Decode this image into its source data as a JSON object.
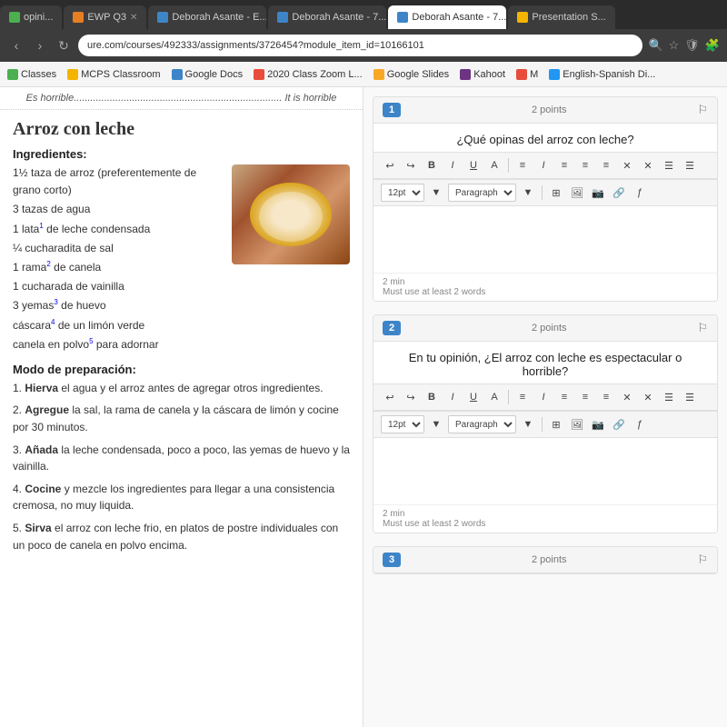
{
  "browser": {
    "tabs": [
      {
        "id": "tab1",
        "label": "opini...",
        "active": false,
        "icon_color": "#4CAF50"
      },
      {
        "id": "tab2",
        "label": "EWP Q3",
        "active": false,
        "icon_color": "#e67e22",
        "has_close": true
      },
      {
        "id": "tab3",
        "label": "Deborah Asante - E...",
        "active": false,
        "icon_color": "#3d85c8",
        "has_close": true
      },
      {
        "id": "tab4",
        "label": "Deborah Asante - 7...",
        "active": false,
        "icon_color": "#3d85c8",
        "has_close": true
      },
      {
        "id": "tab5",
        "label": "Deborah Asante - 7...",
        "active": true,
        "icon_color": "#3d85c8",
        "has_close": true
      },
      {
        "id": "tab6",
        "label": "Presentation S...",
        "active": false,
        "icon_color": "#f4b400"
      }
    ],
    "address": "ure.com/courses/492333/assignments/3726454?module_item_id=10166101",
    "bookmarks": [
      {
        "label": "Classes",
        "icon_color": "#4CAF50"
      },
      {
        "label": "MCPS Classroom",
        "icon_color": "#f4b400"
      },
      {
        "label": "Google Docs",
        "icon_color": "#3d85c8"
      },
      {
        "label": "2020 Class Zoom L...",
        "icon_color": "#e74c3c"
      },
      {
        "label": "Google Slides",
        "icon_color": "#f9a825"
      },
      {
        "label": "Kahoot",
        "icon_color": "#6c3483"
      },
      {
        "label": "M",
        "icon_color": "#e74c3c"
      },
      {
        "label": "English-Spanish Di...",
        "icon_color": "#2196F3"
      }
    ]
  },
  "recipe": {
    "header_spanish": "Es horrible...........................................................................",
    "header_english": "It is horrible",
    "title": "Arroz con leche",
    "ingredients_label": "Ingredientes:",
    "ingredients": [
      "1½ taza de arroz (preferentemente de grano corto)",
      "3 tazas de agua",
      "1 lata¹ de leche condensada",
      "¼ cucharadita de sal",
      "1 rama² de canela",
      "1 cucharada de vainilla",
      "3 yemas³ de huevo",
      "cáscara⁴ de un limón verde",
      "canela en polvo⁵ para adornar"
    ],
    "preparation_label": "Modo de preparación:",
    "steps": [
      {
        "num": "1.",
        "bold": "Hierva",
        "rest": " el agua y el arroz antes de agregar otros ingredientes."
      },
      {
        "num": "2.",
        "bold": "Agregue",
        "rest": " la sal, la rama de canela y la cáscara de limón y cocine por 30 minutos."
      },
      {
        "num": "3.",
        "bold": "Añada",
        "rest": " la leche condensada, poco a poco, las yemas de huevo y la vainilla."
      },
      {
        "num": "4.",
        "bold": "Cocine",
        "rest": " y mezcle los ingredientes para llegar a una consistencia cremosa, no muy liquida."
      },
      {
        "num": "5.",
        "bold": "Sirva",
        "rest": " el arroz con leche frio, en platos de postre individuales con un poco de canela en polvo encima."
      }
    ]
  },
  "quiz": {
    "questions": [
      {
        "number": "1",
        "points": "2 points",
        "text": "¿Qué opinas del arroz con leche?",
        "min_label": "2 min",
        "hint": "Must use at least 2 words"
      },
      {
        "number": "2",
        "points": "2 points",
        "text": "En tu opinión, ¿El arroz con leche es espectacular o horrible?",
        "min_label": "2 min",
        "hint": "Must use at least 2 words"
      },
      {
        "number": "3",
        "points": "2 points",
        "text": "",
        "min_label": "",
        "hint": ""
      }
    ],
    "toolbar": {
      "font_size": "12pt",
      "paragraph": "Paragraph"
    }
  }
}
